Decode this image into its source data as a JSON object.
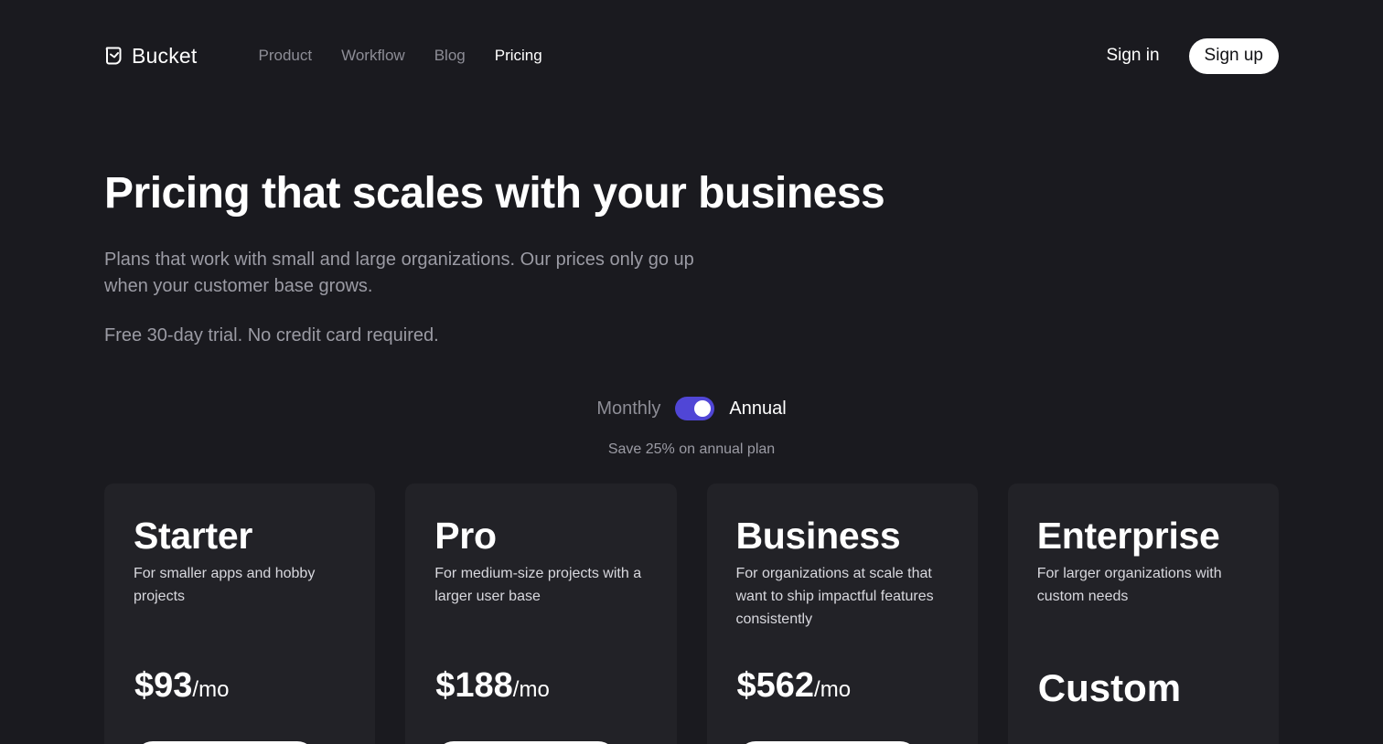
{
  "nav": {
    "brand": "Bucket",
    "links": [
      "Product",
      "Workflow",
      "Blog",
      "Pricing"
    ],
    "active_link": "Pricing",
    "sign_in": "Sign in",
    "sign_up": "Sign up"
  },
  "hero": {
    "title": "Pricing that scales with your business",
    "subtitle": "Plans that work with small and large organizations. Our prices only go up when your customer base grows.",
    "trial": "Free 30-day trial. No credit card required."
  },
  "billing": {
    "monthly_label": "Monthly",
    "annual_label": "Annual",
    "selected": "Annual",
    "save_note": "Save 25% on annual plan"
  },
  "plans": [
    {
      "name": "Starter",
      "description": "For smaller apps and hobby projects",
      "price": "$93",
      "unit": "/mo"
    },
    {
      "name": "Pro",
      "description": "For medium-size projects with a larger user base",
      "price": "$188",
      "unit": "/mo"
    },
    {
      "name": "Business",
      "description": "For organizations at scale that want to ship impactful features consistently",
      "price": "$562",
      "unit": "/mo"
    },
    {
      "name": "Enterprise",
      "description": "For larger organizations with custom needs",
      "price": "Custom",
      "unit": ""
    }
  ],
  "colors": {
    "background": "#1a1a1f",
    "card": "#222227",
    "accent": "#5046d6",
    "muted_text": "#9b9ba4"
  }
}
